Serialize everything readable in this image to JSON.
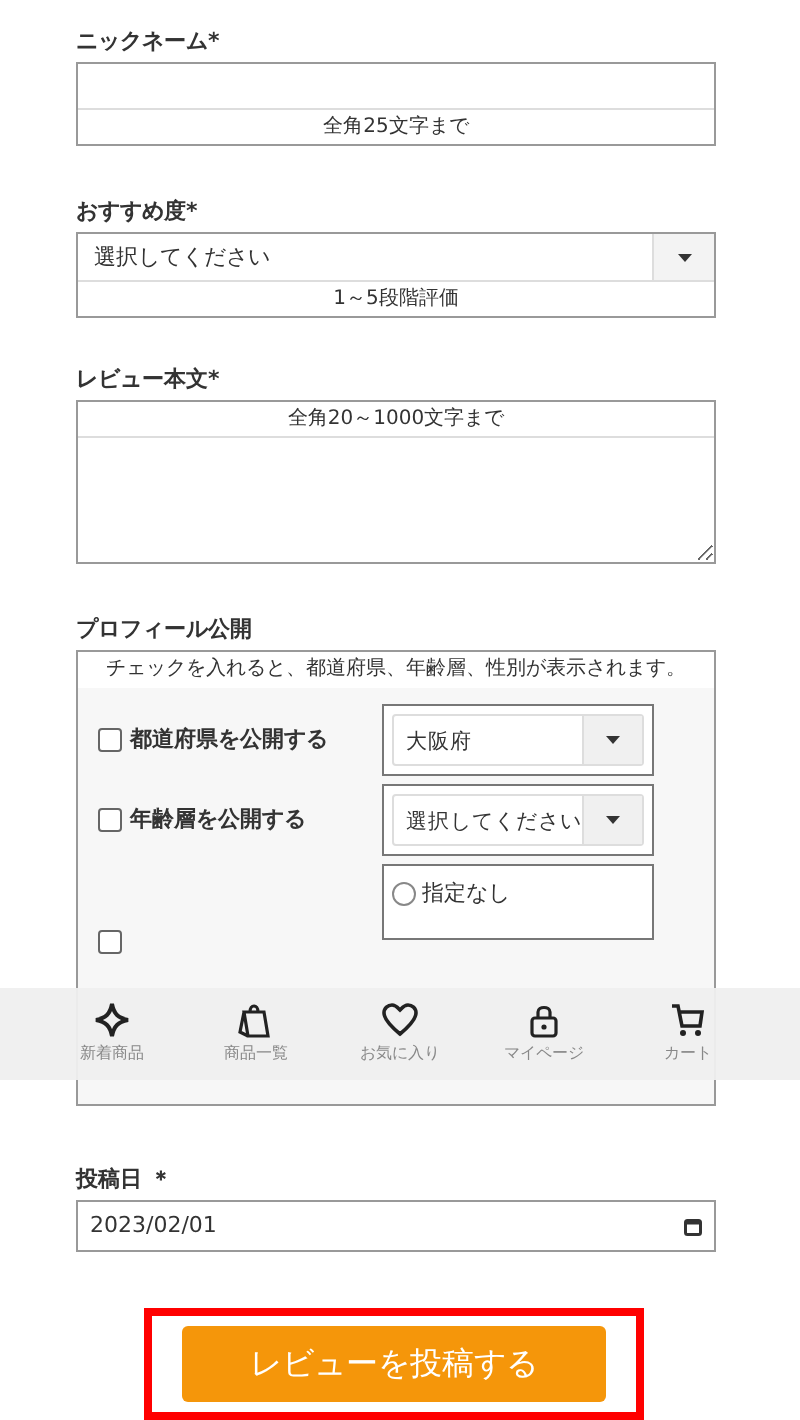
{
  "nickname": {
    "label": "ニックネーム*",
    "hint": "全角25文字まで"
  },
  "rating": {
    "label": "おすすめ度*",
    "value": "選択してください",
    "hint": "1～5段階評価"
  },
  "review": {
    "label": "レビュー本文*",
    "hint": "全角20～1000文字まで"
  },
  "profile": {
    "label": "プロフィール公開",
    "note": "チェックを入れると、都道府県、年齢層、性別が表示されます。",
    "rows": [
      {
        "kind": "select",
        "label": "都道府県を公開する",
        "checked": false,
        "value": "大阪府"
      },
      {
        "kind": "select",
        "label": "年齢層を公開する",
        "checked": false,
        "value": "選択してください"
      },
      {
        "kind": "radio",
        "checked": false,
        "options": [
          {
            "label": "指定なし",
            "selected": false
          }
        ]
      }
    ]
  },
  "nav": [
    {
      "label": "新着商品"
    },
    {
      "label": "商品一覧"
    },
    {
      "label": "お気に入り"
    },
    {
      "label": "マイページ"
    },
    {
      "label": "カート"
    }
  ],
  "post_date": {
    "label": "投稿日 ＊",
    "value": "2023/02/01"
  },
  "submit": {
    "label": "レビューを投稿する"
  }
}
